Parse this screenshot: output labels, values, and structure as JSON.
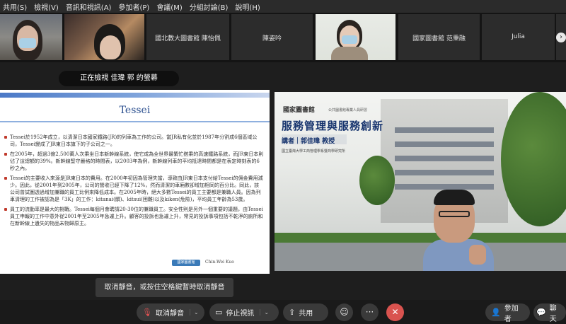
{
  "menu": [
    "共用(S)",
    "檢視(V)",
    "音訊和視訊(A)",
    "參加者(P)",
    "會議(M)",
    "分組討論(B)",
    "說明(H)"
  ],
  "participants": [
    "國北教大圖書館 陳怡佩",
    "陳姿吟",
    "國家圖書館 范秉融",
    "Julia"
  ],
  "viewing_banner": "正在檢視 佳瑋 郭 的螢幕",
  "slide": {
    "title": "Tessei",
    "paragraphs": [
      "Tessei於1952年成立，以清潔日本國家鐵路(JR)的列車為工作的公司。當JR私有化並於1987年分割成6個區域公司，Tessei變成了JR東日本旗下的子公司之一。",
      "在2005年，超過3億2,500萬人次乘坐日本新幹線系統，使它成為全世界最繁忙搭乘的高速鐵路系統，而JR東日本則佔了這總額的39%。新幹線堅守嚴格的時間表，以2003年為例，新幹線列車的平均抵達時間都是在表定時刻表的6秒之內。",
      "Tessei的主要收入來源是JR東日本的費用。在2000年初因為管理失當，導致由JR東日本支付給Tessei的佣金費用減少。因此，從2001年到2005年，公司的營收已經下降了12%，然而清潔的車廂數卻增加相同的百分比。同此，該公司曾試圖透過增加兼職的員工比例來降低成本。在2005年時，絕大多數Tessei的員工主要都是兼職人員。因為列車清理的工作被認為是「3K」的工作：kitanai(髒)、kitsui(困難)以及kiken(危險)，平均員工年齡為53歲。",
      "員工的流動率是最大的挑戰。Tessei每個月會聘請20-30位的兼職員工。安全性則是另外一個重要的議題，由Tessei員工申報的工作中意外從2001年至2005年急遽上升。顧客的投訴也急遽上升，常見的投訴事項包括不乾淨的廁所和在新幹線上遺失的物品未物歸原主。"
    ],
    "logo": "國家圖書館",
    "author": "Chin-Wei Kuo"
  },
  "speaker": {
    "library": "國家圖書館",
    "library_sub": "公共圖書館專業人員研習",
    "course_title": "服務管理與服務創新",
    "lecturer": "講者｜郭佳瑋 教授",
    "lecturer_sub": "國立臺灣大學工商管理學系暨商學研究所"
  },
  "toast": "取消靜音，或按住空格鍵暫時取消靜音",
  "toolbar": {
    "unmute": "取消靜音",
    "stop_video": "停止視訊",
    "share": "共用",
    "participants": "參加者",
    "chat": "聊天"
  }
}
